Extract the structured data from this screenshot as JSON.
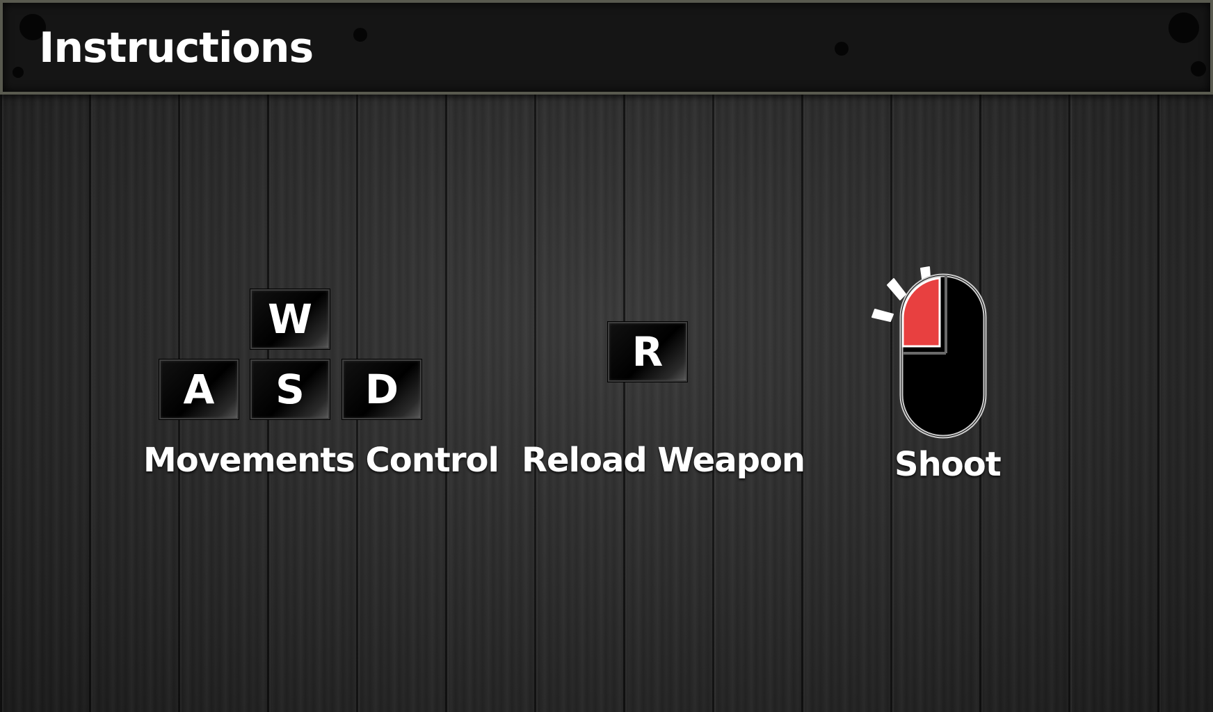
{
  "header": {
    "title": "Instructions"
  },
  "movement": {
    "keys": {
      "up": "W",
      "left": "A",
      "down": "S",
      "right": "D"
    },
    "label": "Movements Control"
  },
  "reload": {
    "key": "R",
    "label": "Reload Weapon"
  },
  "shoot": {
    "icon": "mouse-left-click-icon",
    "label": "Shoot"
  },
  "colors": {
    "accent": "#e84040",
    "key_bg": "#000000",
    "text": "#ffffff"
  }
}
